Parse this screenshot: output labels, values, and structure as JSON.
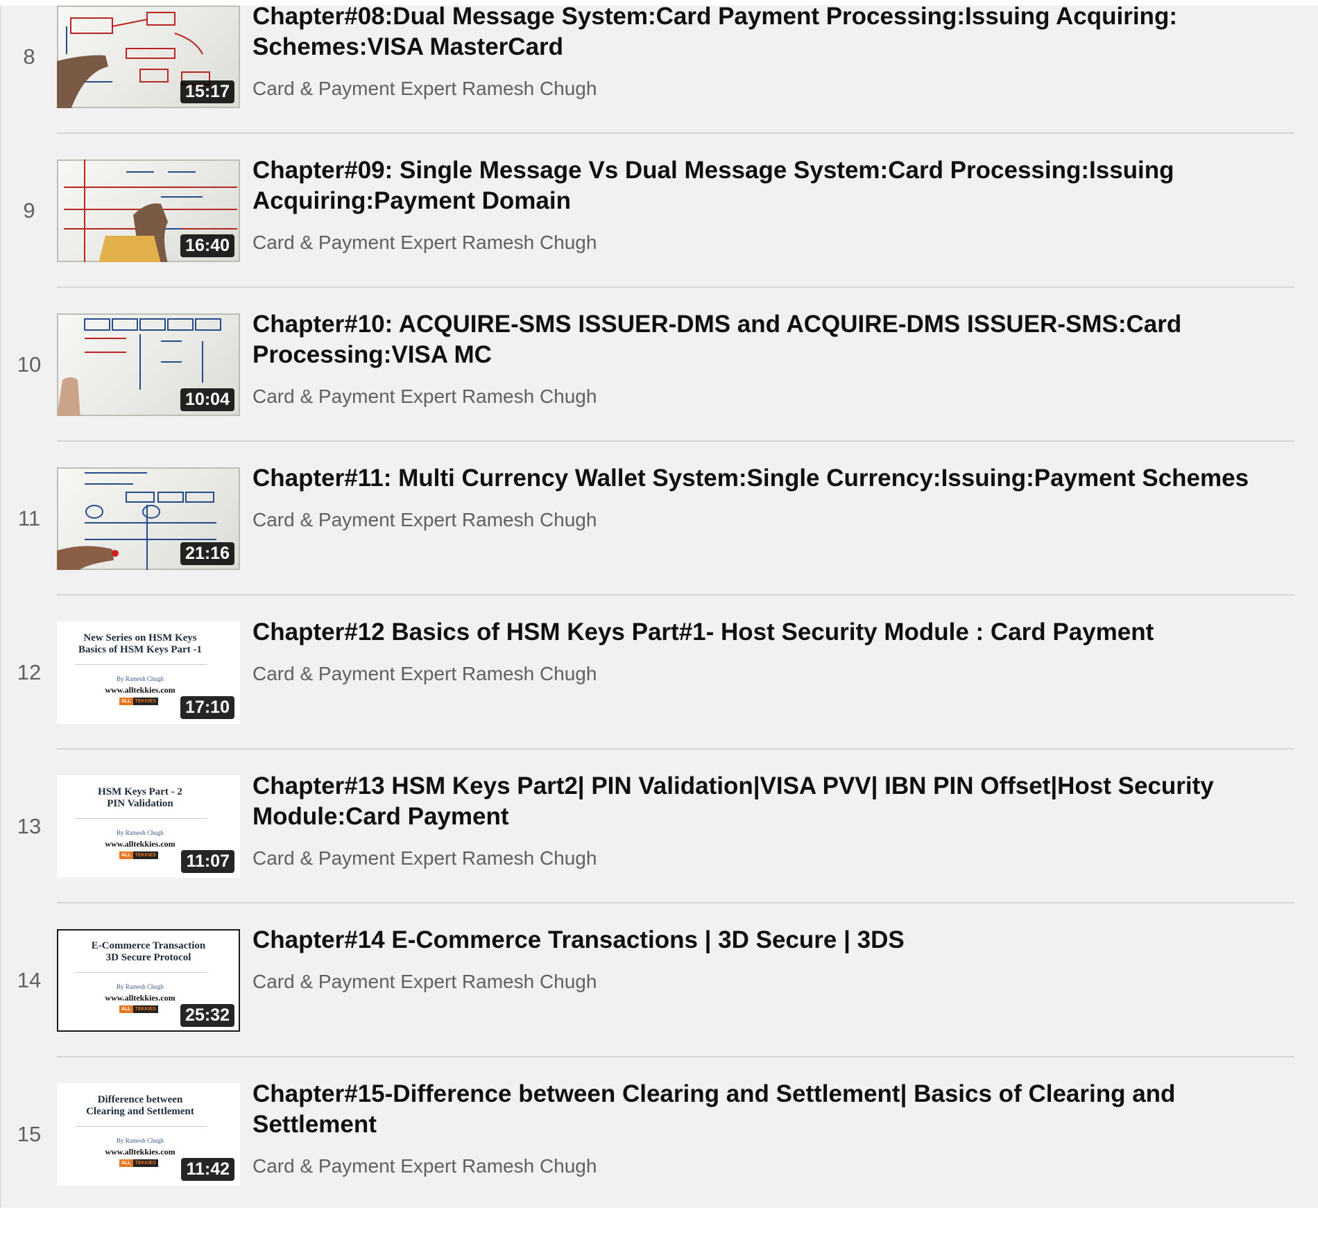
{
  "playlist": {
    "items": [
      {
        "index": "8",
        "title": "Chapter#08:Dual Message System:Card Payment Processing:Issuing Acquiring: Schemes:VISA MasterCard",
        "channel": "Card & Payment Expert Ramesh Chugh",
        "duration": "15:17",
        "thumbnail": "whiteboard-drawing"
      },
      {
        "index": "9",
        "title": "Chapter#09: Single Message Vs Dual Message System:Card Processing:Issuing Acquiring:Payment Domain",
        "channel": "Card & Payment Expert Ramesh Chugh",
        "duration": "16:40",
        "thumbnail": "whiteboard-drawing"
      },
      {
        "index": "10",
        "title": "Chapter#10: ACQUIRE-SMS ISSUER-DMS and ACQUIRE-DMS ISSUER-SMS:Card Processing:VISA MC",
        "channel": "Card & Payment Expert Ramesh Chugh",
        "duration": "10:04",
        "thumbnail": "whiteboard-drawing"
      },
      {
        "index": "11",
        "title": "Chapter#11: Multi Currency Wallet System:Single Currency:Issuing:Payment Schemes",
        "channel": "Card & Payment Expert Ramesh Chugh",
        "duration": "21:16",
        "thumbnail": "whiteboard-drawing"
      },
      {
        "index": "12",
        "title": "Chapter#12 Basics of HSM Keys Part#1- Host Security Module : Card Payment",
        "channel": "Card & Payment Expert Ramesh Chugh",
        "duration": "17:10",
        "thumbnail": "title-slide",
        "slide": {
          "line1": "New Series on HSM Keys",
          "line2": "Basics of HSM Keys Part -1",
          "byline": "By Ramesh Chugh",
          "url": "www.alltekkies.com",
          "logo_a": "ALL",
          "logo_b": "TEKKIES"
        }
      },
      {
        "index": "13",
        "title": "Chapter#13 HSM Keys Part2| PIN Validation|VISA PVV| IBN PIN Offset|Host Security Module:Card Payment",
        "channel": "Card & Payment Expert Ramesh Chugh",
        "duration": "11:07",
        "thumbnail": "title-slide",
        "slide": {
          "line1": "HSM Keys Part - 2",
          "line2": "PIN Validation",
          "byline": "By Ramesh Chugh",
          "url": "www.alltekkies.com",
          "logo_a": "ALL",
          "logo_b": "TEKKIES"
        }
      },
      {
        "index": "14",
        "title": "Chapter#14 E-Commerce Transactions | 3D Secure | 3DS",
        "channel": "Card & Payment Expert Ramesh Chugh",
        "duration": "25:32",
        "thumbnail": "title-slide",
        "slide": {
          "line1": "E-Commerce Transaction",
          "line2": "3D Secure Protocol",
          "byline": "By Ramesh Chugh",
          "url": "www.alltekkies.com",
          "logo_a": "ALL",
          "logo_b": "TEKKIES"
        }
      },
      {
        "index": "15",
        "title": "Chapter#15-Difference between Clearing and Settlement| Basics of Clearing and Settlement",
        "channel": "Card & Payment Expert Ramesh Chugh",
        "duration": "11:42",
        "thumbnail": "title-slide",
        "slide": {
          "line1": "Difference between",
          "line2": "Clearing and Settlement",
          "byline": "By Ramesh Chugh",
          "url": "www.alltekkies.com",
          "logo_a": "ALL",
          "logo_b": "TEKKIES"
        }
      }
    ]
  },
  "colors": {
    "background": "#f1f1f1",
    "title_text": "#0f0f0f",
    "secondary_text": "#606060",
    "duration_badge": "#000000",
    "divider": "#d6d6d6"
  }
}
